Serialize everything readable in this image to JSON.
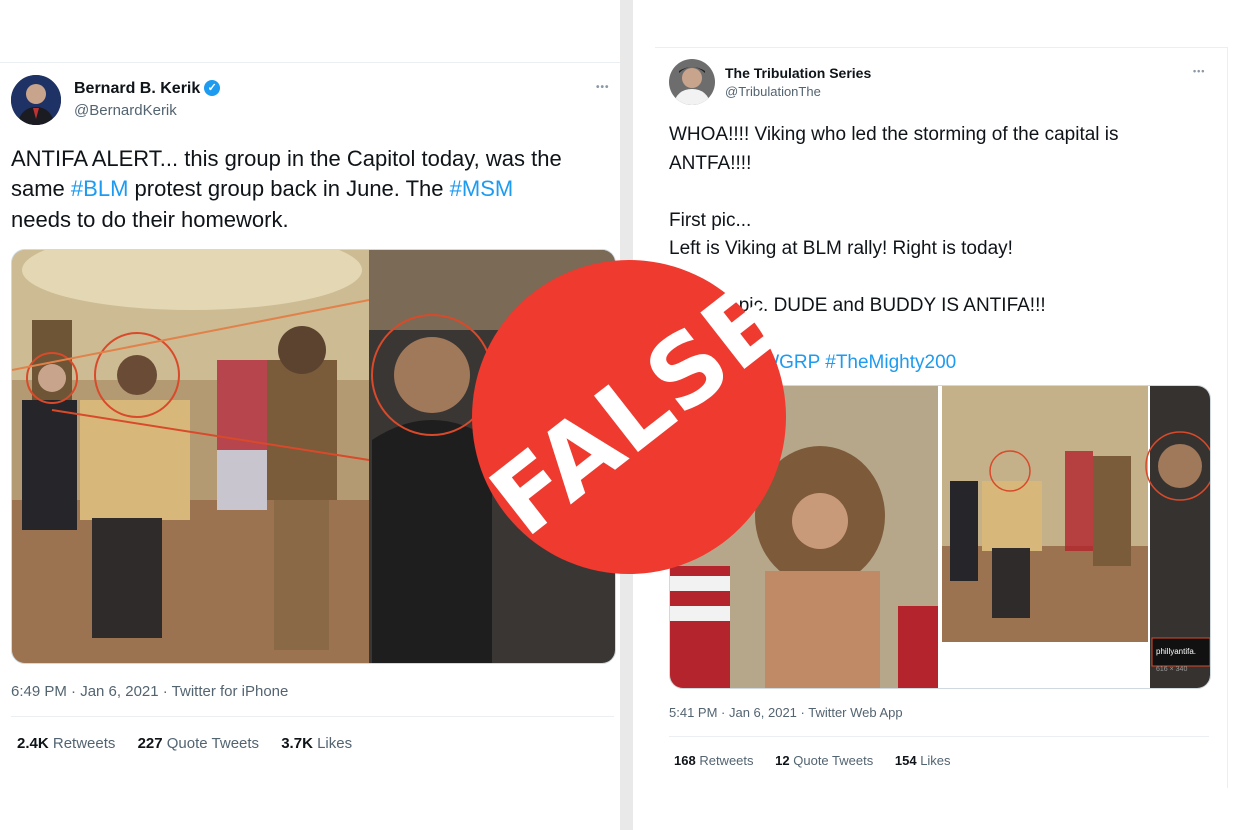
{
  "left_tweet": {
    "author_name": "Bernard B. Kerik",
    "verified_icon": "✓",
    "handle": "@BernardKerik",
    "more_icon": "•••",
    "text_parts": {
      "l1": "ANTIFA ALERT... this group in the Capitol today, was the",
      "l2a": "same ",
      "l2_tag1": "#BLM",
      "l2b": " protest group back in June. The ",
      "l2_tag2": "#MSM",
      "l3": "needs to do their homework."
    },
    "timestamp": "6:49 PM · Jan 6, 2021 · Twitter for iPhone",
    "stats": [
      {
        "count": "2.4K",
        "label": "Retweets"
      },
      {
        "count": "227",
        "label": "Quote Tweets"
      },
      {
        "count": "3.7K",
        "label": "Likes"
      }
    ]
  },
  "right_tweet": {
    "author_name": "The Tribulation Series",
    "handle": "@TribulationThe",
    "more_icon": "•••",
    "text_parts": {
      "l1": "WHOA!!!! Viking who led the storming of the capital is",
      "l2": "ANTFA!!!!",
      "l4": "First pic...",
      "l5": "Left is Viking at BLM rally! Right is today!",
      "l7": "Second pic. DUDE and BUDDY IS ANTIFA!!!",
      "l9_tags": "#Trump #TWGRP #TheMighty200"
    },
    "image_watermark": "phillyantifa.",
    "image_size": "616 × 340",
    "timestamp": "5:41 PM · Jan 6, 2021 · Twitter Web App",
    "stats": [
      {
        "count": "168",
        "label": "Retweets"
      },
      {
        "count": "12",
        "label": "Quote Tweets"
      },
      {
        "count": "154",
        "label": "Likes"
      }
    ]
  },
  "badge": {
    "text": "FALSE",
    "color": "#ee3a2f"
  }
}
